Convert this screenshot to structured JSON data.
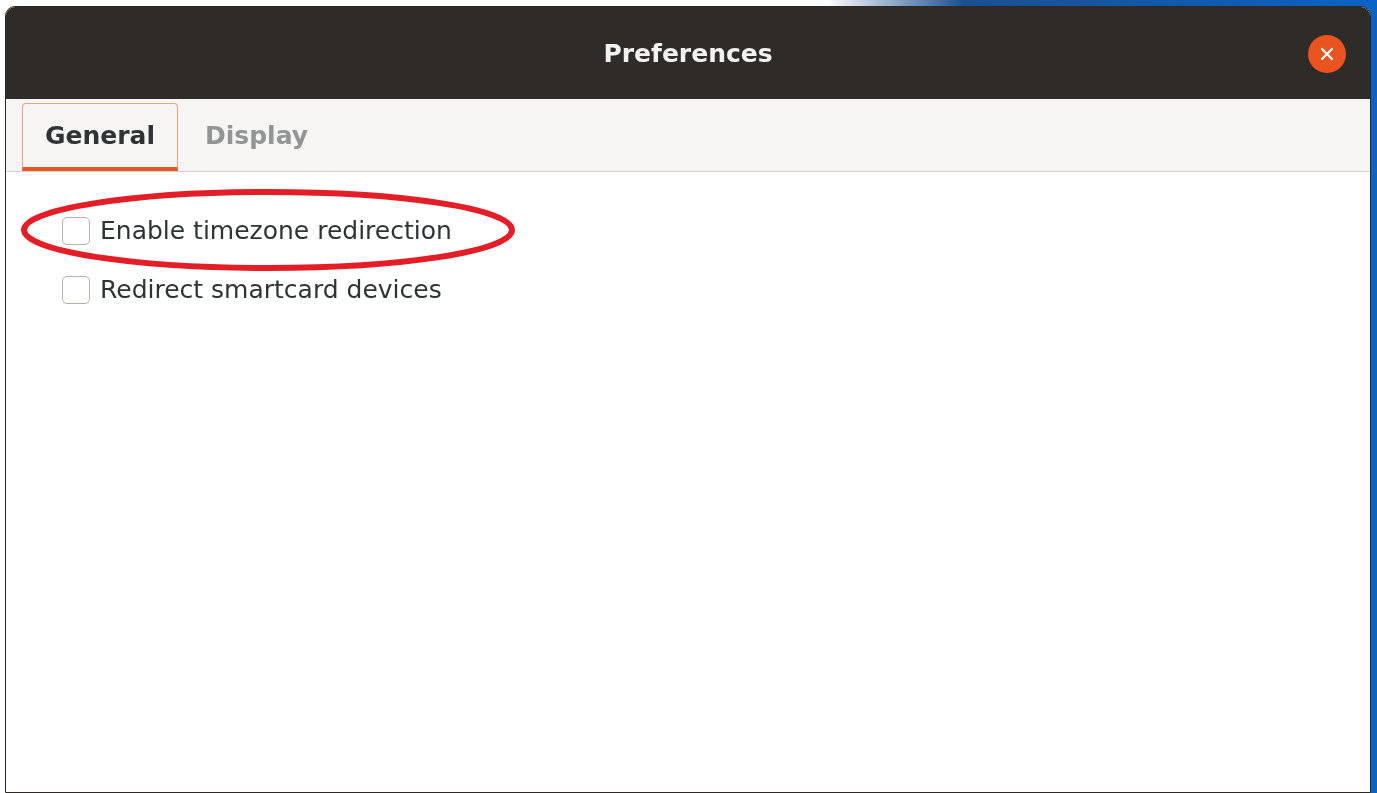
{
  "window": {
    "title": "Preferences"
  },
  "tabs": [
    {
      "label": "General",
      "selected": true
    },
    {
      "label": "Display",
      "selected": false
    }
  ],
  "options": [
    {
      "label": "Enable timezone redirection",
      "checked": false,
      "annotation": {
        "kind": "ellipse"
      }
    },
    {
      "label": "Redirect smartcard devices",
      "checked": false
    }
  ]
}
